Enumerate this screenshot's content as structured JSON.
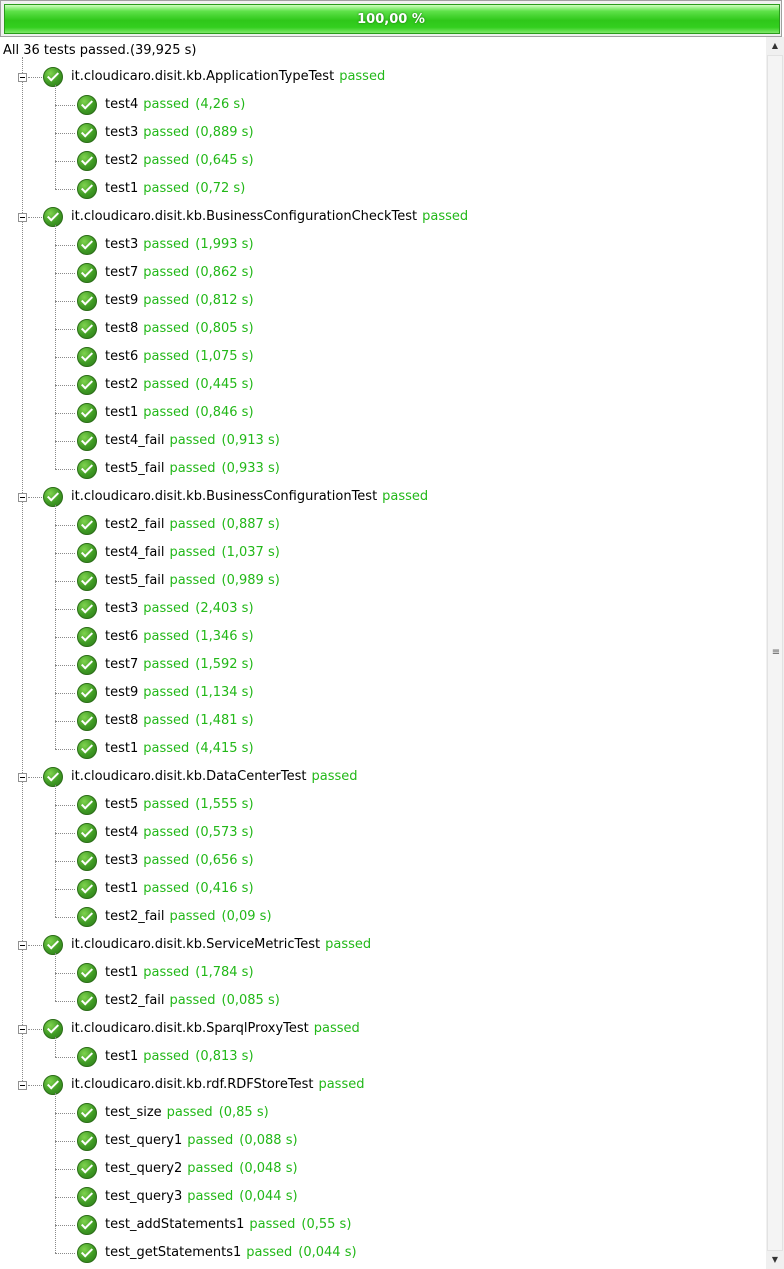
{
  "progress": {
    "percent_text": "100,00 %",
    "value": 1.0,
    "color": "#33cf1f"
  },
  "summary": "All 36 tests passed.(39,925 s)",
  "colors": {
    "passed": "#22b818",
    "check_icon": "#3f9a24"
  },
  "suites": [
    {
      "name": "it.cloudicaro.disit.kb.ApplicationTypeTest",
      "status": "passed",
      "tests": [
        {
          "name": "test4",
          "status": "passed",
          "time": "(4,26 s)"
        },
        {
          "name": "test3",
          "status": "passed",
          "time": "(0,889 s)"
        },
        {
          "name": "test2",
          "status": "passed",
          "time": "(0,645 s)"
        },
        {
          "name": "test1",
          "status": "passed",
          "time": "(0,72 s)"
        }
      ]
    },
    {
      "name": "it.cloudicaro.disit.kb.BusinessConfigurationCheckTest",
      "status": "passed",
      "tests": [
        {
          "name": "test3",
          "status": "passed",
          "time": "(1,993 s)"
        },
        {
          "name": "test7",
          "status": "passed",
          "time": "(0,862 s)"
        },
        {
          "name": "test9",
          "status": "passed",
          "time": "(0,812 s)"
        },
        {
          "name": "test8",
          "status": "passed",
          "time": "(0,805 s)"
        },
        {
          "name": "test6",
          "status": "passed",
          "time": "(1,075 s)"
        },
        {
          "name": "test2",
          "status": "passed",
          "time": "(0,445 s)"
        },
        {
          "name": "test1",
          "status": "passed",
          "time": "(0,846 s)"
        },
        {
          "name": "test4_fail",
          "status": "passed",
          "time": "(0,913 s)"
        },
        {
          "name": "test5_fail",
          "status": "passed",
          "time": "(0,933 s)"
        }
      ]
    },
    {
      "name": "it.cloudicaro.disit.kb.BusinessConfigurationTest",
      "status": "passed",
      "tests": [
        {
          "name": "test2_fail",
          "status": "passed",
          "time": "(0,887 s)"
        },
        {
          "name": "test4_fail",
          "status": "passed",
          "time": "(1,037 s)"
        },
        {
          "name": "test5_fail",
          "status": "passed",
          "time": "(0,989 s)"
        },
        {
          "name": "test3",
          "status": "passed",
          "time": "(2,403 s)"
        },
        {
          "name": "test6",
          "status": "passed",
          "time": "(1,346 s)"
        },
        {
          "name": "test7",
          "status": "passed",
          "time": "(1,592 s)"
        },
        {
          "name": "test9",
          "status": "passed",
          "time": "(1,134 s)"
        },
        {
          "name": "test8",
          "status": "passed",
          "time": "(1,481 s)"
        },
        {
          "name": "test1",
          "status": "passed",
          "time": "(4,415 s)"
        }
      ]
    },
    {
      "name": "it.cloudicaro.disit.kb.DataCenterTest",
      "status": "passed",
      "tests": [
        {
          "name": "test5",
          "status": "passed",
          "time": "(1,555 s)"
        },
        {
          "name": "test4",
          "status": "passed",
          "time": "(0,573 s)"
        },
        {
          "name": "test3",
          "status": "passed",
          "time": "(0,656 s)"
        },
        {
          "name": "test1",
          "status": "passed",
          "time": "(0,416 s)"
        },
        {
          "name": "test2_fail",
          "status": "passed",
          "time": "(0,09 s)"
        }
      ]
    },
    {
      "name": "it.cloudicaro.disit.kb.ServiceMetricTest",
      "status": "passed",
      "tests": [
        {
          "name": "test1",
          "status": "passed",
          "time": "(1,784 s)"
        },
        {
          "name": "test2_fail",
          "status": "passed",
          "time": "(0,085 s)"
        }
      ]
    },
    {
      "name": "it.cloudicaro.disit.kb.SparqlProxyTest",
      "status": "passed",
      "tests": [
        {
          "name": "test1",
          "status": "passed",
          "time": "(0,813 s)"
        }
      ]
    },
    {
      "name": "it.cloudicaro.disit.kb.rdf.RDFStoreTest",
      "status": "passed",
      "tests": [
        {
          "name": "test_size",
          "status": "passed",
          "time": "(0,85 s)"
        },
        {
          "name": "test_query1",
          "status": "passed",
          "time": "(0,088 s)"
        },
        {
          "name": "test_query2",
          "status": "passed",
          "time": "(0,048 s)"
        },
        {
          "name": "test_query3",
          "status": "passed",
          "time": "(0,044 s)"
        },
        {
          "name": "test_addStatements1",
          "status": "passed",
          "time": "(0,55 s)"
        },
        {
          "name": "test_getStatements1",
          "status": "passed",
          "time": "(0,044 s)"
        }
      ]
    }
  ],
  "icons": {
    "suite": "check-circle-icon",
    "test": "check-circle-icon",
    "expander": "collapse-minus-icon",
    "scroll_up": "arrow-up-icon",
    "scroll_down": "arrow-down-icon",
    "scroll_grip": "grip-icon"
  }
}
